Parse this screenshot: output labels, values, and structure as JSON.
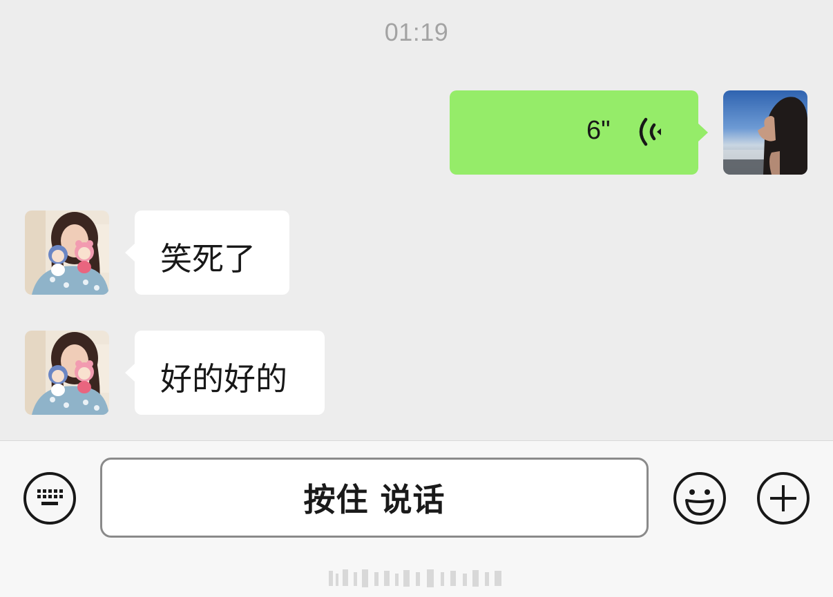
{
  "chat": {
    "timestamp": "01:19",
    "messages": [
      {
        "side": "right",
        "type": "voice",
        "duration": "6\""
      },
      {
        "side": "left",
        "type": "text",
        "text": "笑死了"
      },
      {
        "side": "left",
        "type": "text",
        "text": "好的好的"
      }
    ]
  },
  "input_bar": {
    "hold_to_talk_label": "按住 说话",
    "left_icon": "keyboard-icon",
    "emoji_icon": "smiley-icon",
    "plus_icon": "plus-icon"
  },
  "colors": {
    "background": "#ededed",
    "sent_bubble": "#95ec69",
    "received_bubble": "#ffffff",
    "timestamp": "#a3a3a3",
    "input_bar": "#f7f7f7"
  }
}
